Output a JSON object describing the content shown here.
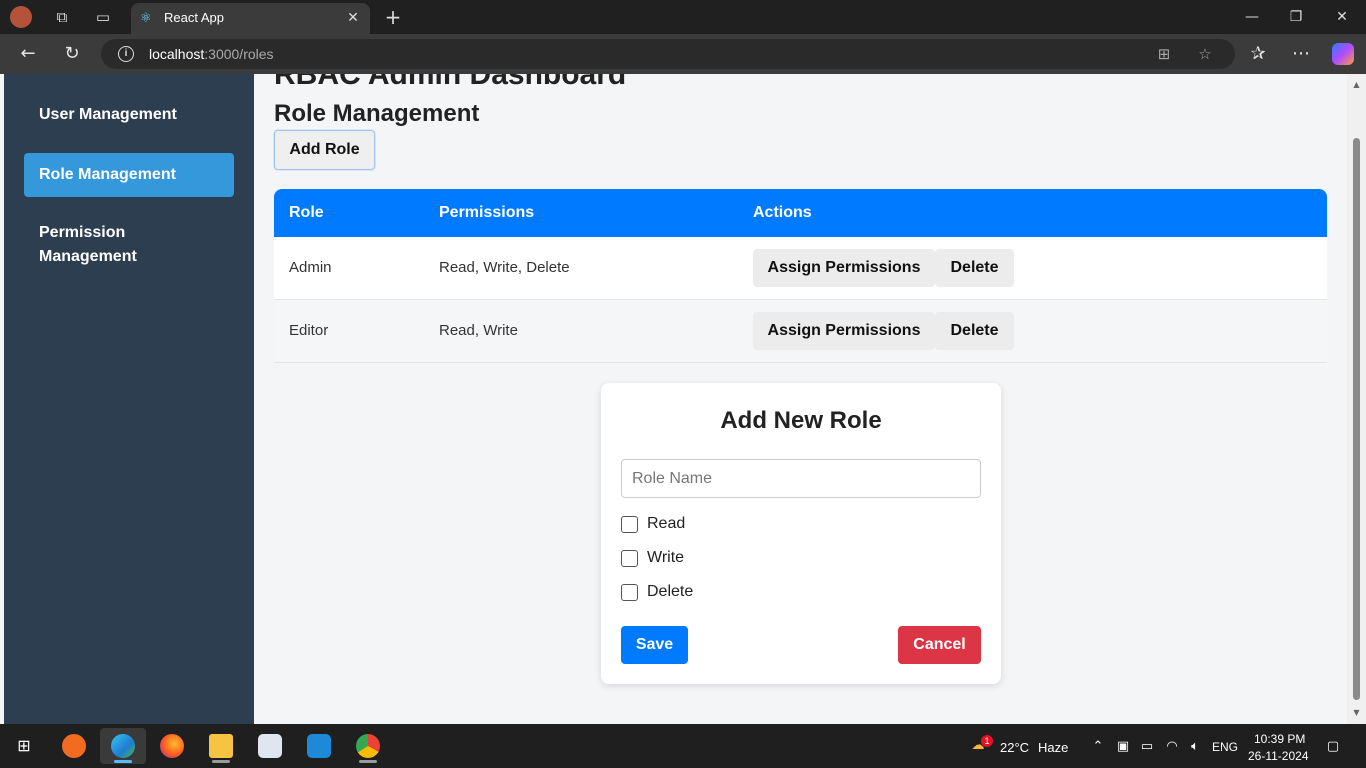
{
  "browser": {
    "tab_title": "React App",
    "url_host": "localhost",
    "url_path": ":3000/roles"
  },
  "sidebar": {
    "items": [
      {
        "label": "User Management",
        "active": false
      },
      {
        "label": "Role Management",
        "active": true
      },
      {
        "label": "Permission Management",
        "active": false
      }
    ]
  },
  "main": {
    "dashboard_title": "RBAC Admin Dashboard",
    "page_title": "Role Management",
    "add_role_label": "Add Role"
  },
  "table": {
    "headers": [
      "Role",
      "Permissions",
      "Actions"
    ],
    "rows": [
      {
        "role": "Admin",
        "permissions": "Read, Write, Delete",
        "assign_label": "Assign Permissions",
        "delete_label": "Delete"
      },
      {
        "role": "Editor",
        "permissions": "Read, Write",
        "assign_label": "Assign Permissions",
        "delete_label": "Delete"
      }
    ]
  },
  "modal": {
    "title": "Add New Role",
    "role_name_value": "",
    "role_name_placeholder": "Role Name",
    "permissions": [
      {
        "label": "Read",
        "checked": false
      },
      {
        "label": "Write",
        "checked": false
      },
      {
        "label": "Delete",
        "checked": false
      }
    ],
    "save_label": "Save",
    "cancel_label": "Cancel"
  },
  "taskbar": {
    "weather_temp": "22°C",
    "weather_desc": "Haze",
    "weather_badge": "1",
    "language": "ENG",
    "time": "10:39 PM",
    "date": "26-11-2024"
  },
  "colors": {
    "sidebar_bg": "#2c3e50",
    "sidebar_active": "#3498db",
    "table_header": "#007bff",
    "save_button": "#007bff",
    "cancel_button": "#dc3545"
  }
}
